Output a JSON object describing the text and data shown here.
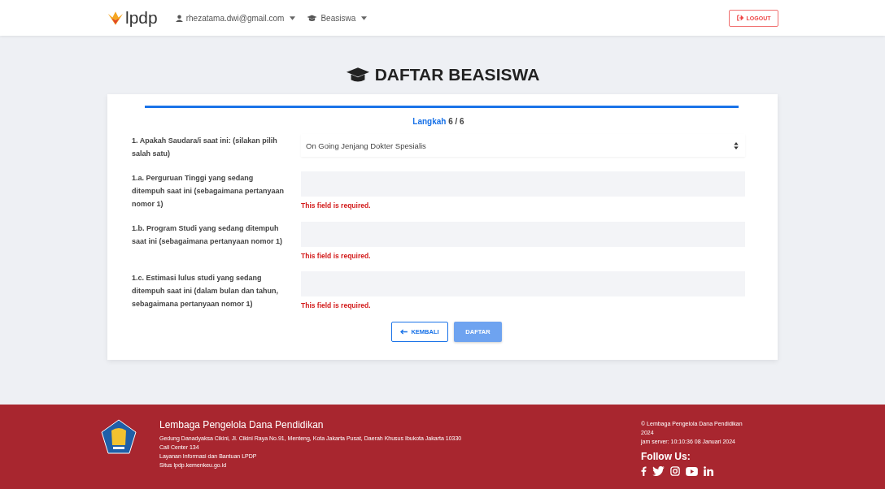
{
  "navbar": {
    "brand": "lpdp",
    "user_menu": "rhezatama.dwi@gmail.com",
    "program_menu": "Beasiswa",
    "logout": "LOGOUT"
  },
  "page_title": "DAFTAR BEASISWA",
  "progress": {
    "level": 1.0,
    "step_label": "Langkah",
    "step_value": "6 / 6"
  },
  "fields": [
    {
      "kind": "select",
      "label": "1. Apakah Saudara/i saat ini: (silakan pilih salah satu)",
      "value": "On Going Jenjang Dokter Spesialis"
    },
    {
      "kind": "input",
      "label": "1.a. Perguruan Tinggi yang sedang ditempuh saat ini (sebagaimana pertanyaan nomor 1)",
      "error": "This field is required."
    },
    {
      "kind": "input",
      "label": "1.b. Program Studi yang sedang ditempuh saat ini (sebagaimana pertanyaan nomor 1)",
      "error": "This field is required."
    },
    {
      "kind": "input",
      "label": "1.c. Estimasi lulus studi yang sedang ditempuh saat ini (dalam bulan dan tahun, sebagaimana pertanyaan nomor 1)",
      "error": "This field is required."
    }
  ],
  "buttons": {
    "back": "KEMBALI",
    "submit": "DAFTAR"
  },
  "footer": {
    "org_name": "Lembaga Pengelola Dana Pendidikan",
    "lines": [
      "Gedung Danadyaksa Cikini, Jl. Cikini Raya No.91, Menteng, Kota Jakarta Pusat, Daerah Khusus Ibukota Jakarta 10330",
      "Call Center 134",
      "Layanan Informasi dan Bantuan LPDP",
      "Situs lpdp.kemenkeu.go.id"
    ],
    "copyright": "© Lembaga Pengelola Dana Pendidikan 2024",
    "server_time": "jam server: 10:10:36 08 Januari 2024",
    "follow_title": "Follow Us:",
    "socials": [
      {
        "kind": "facebook"
      },
      {
        "kind": "twitter"
      },
      {
        "kind": "instagram"
      },
      {
        "kind": "youtube"
      },
      {
        "kind": "linkedin"
      }
    ]
  }
}
